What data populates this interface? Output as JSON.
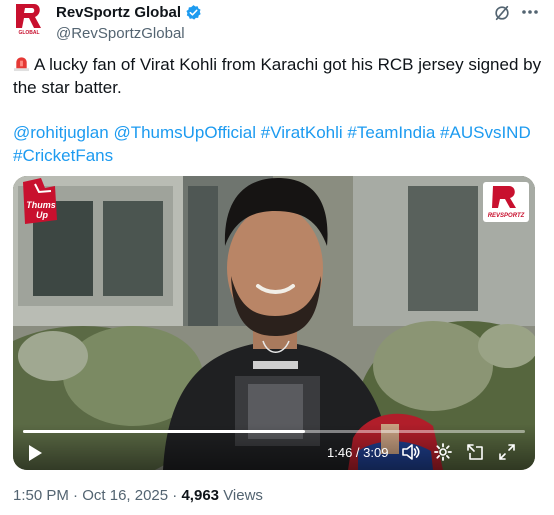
{
  "author": {
    "display_name": "RevSportz Global",
    "handle": "@RevSportzGlobal",
    "avatar_icon": "revsportz-logo",
    "verified_icon": "verified-badge-icon"
  },
  "tweet": {
    "text": "A lucky fan of Virat Kohli from Karachi got his RCB jersey signed by the star batter.",
    "hashtags": [
      "@rohitjuglan",
      "@ThumsUpOfficial",
      "#ViratKohli",
      "#TeamIndia",
      "#AUSvsIND",
      "#CricketFans"
    ]
  },
  "video": {
    "current_time": "1:46",
    "duration": "3:09",
    "time_separator": " / ",
    "progress": 0.561,
    "sponsor_logo_text": [
      "Thums",
      "Up"
    ],
    "brand_logo_text": "REVSPORTZ"
  },
  "footer": {
    "time": "1:50 PM",
    "date": "Oct 16, 2025",
    "separator": " · ",
    "views_count": "4,963",
    "views_label": "Views"
  },
  "colors": {
    "link": "#1d9bf0",
    "brand_red": "#c8102e",
    "verified": "#1d9bf0",
    "text_secondary": "#536471"
  }
}
